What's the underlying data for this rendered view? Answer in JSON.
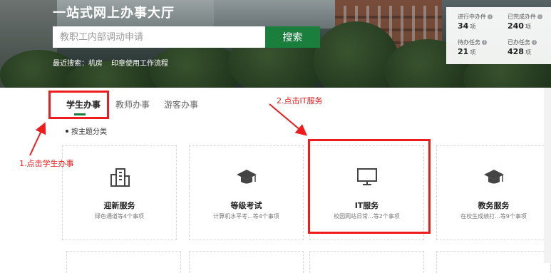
{
  "hero": {
    "title": "一站式网上办事大厅",
    "search_placeholder": "教职工内部调动申请",
    "search_button": "搜索",
    "recent_label": "最近搜索：机房",
    "recent_link": "印章使用工作流程"
  },
  "stats": [
    {
      "label": "进行中办件",
      "value": "34",
      "unit": "项"
    },
    {
      "label": "已完成办件",
      "value": "240",
      "unit": "项"
    },
    {
      "label": "待办任务",
      "value": "21",
      "unit": "项"
    },
    {
      "label": "已办任务",
      "value": "428",
      "unit": "项"
    }
  ],
  "tabs": [
    {
      "label": "学生办事",
      "active": true
    },
    {
      "label": "教师办事",
      "active": false
    },
    {
      "label": "游客办事",
      "active": false
    }
  ],
  "section_label": "按主题分类",
  "cards": [
    {
      "title": "迎新服务",
      "desc": "绿色通道等4个事项",
      "icon": "building-icon"
    },
    {
      "title": "等级考试",
      "desc": "计算机水平考...等4个事项",
      "icon": "graduation-cap-icon"
    },
    {
      "title": "IT服务",
      "desc": "校园网站日常...等2个事项",
      "icon": "monitor-icon"
    },
    {
      "title": "教务服务",
      "desc": "在校生成绩打...等9个事项",
      "icon": "graduation-cap-icon"
    }
  ],
  "annotations": {
    "step1": "1.点击学生办事",
    "step2": "2.点击IT服务",
    "color": "#ee1c1c"
  },
  "colors": {
    "accent": "#1a7f3c",
    "annotation": "#ee1c1c"
  }
}
